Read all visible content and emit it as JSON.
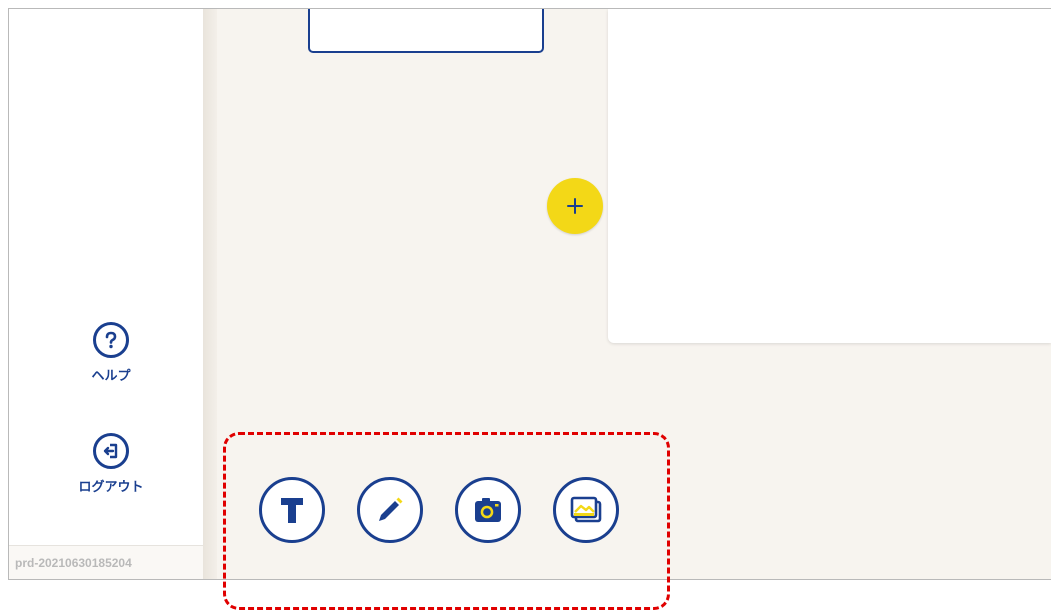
{
  "sidebar": {
    "help": {
      "label": "ヘルプ",
      "icon": "question-icon"
    },
    "logout": {
      "label": "ログアウト",
      "icon": "logout-icon"
    },
    "version": "prd-20210630185204"
  },
  "canvas": {
    "add_button": {
      "icon": "plus-icon"
    }
  },
  "toolbar": {
    "tools": [
      {
        "name": "text",
        "icon": "text-icon"
      },
      {
        "name": "pen",
        "icon": "pencil-icon"
      },
      {
        "name": "camera",
        "icon": "camera-icon"
      },
      {
        "name": "gallery",
        "icon": "image-gallery-icon"
      }
    ]
  },
  "colors": {
    "brand_blue": "#1a3f8f",
    "accent_yellow": "#f3d817",
    "highlight_red": "#e00000",
    "canvas_bg": "#f7f4ef"
  }
}
